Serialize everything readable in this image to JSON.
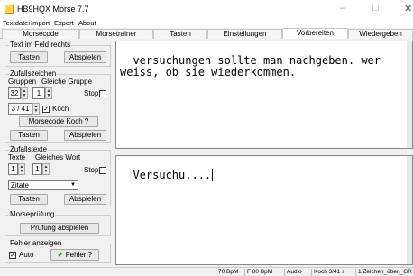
{
  "window": {
    "title": "HB9HQX Morse 7.7",
    "minimize": "–",
    "maximize": "□",
    "close": "✕"
  },
  "menu": [
    "Textdatei",
    "Import",
    "Export",
    "About"
  ],
  "tabs": [
    "Morsecode",
    "Morsetrainer",
    "Tasten",
    "Einstellungen",
    "Vorbereiten",
    "Wiedergeben"
  ],
  "active_tab": "Vorbereiten",
  "text_im_feld": {
    "legend": "Text im Feld rechts",
    "tasten": "Tasten",
    "abspielen": "Abspielen"
  },
  "zufallszeichen": {
    "legend": "Zufallszeichen",
    "gruppen_label": "Gruppen",
    "gleiche_gruppe_label": "Gleiche Gruppe",
    "gruppen_value": "32",
    "gleiche_value": "1",
    "stop_label": "Stop",
    "stop_checked": false,
    "koch_value": "3 / 41",
    "koch_label": "Koch",
    "koch_checked": true,
    "morsecode_koch_button": "Morsecode Koch ?",
    "tasten": "Tasten",
    "abspielen": "Abspielen"
  },
  "zufallstexte": {
    "legend": "Zufallstexte",
    "texte_label": "Texte",
    "gleiches_wort_label": "Gleiches Wort",
    "texte_value": "1",
    "wort_value": "1",
    "stop_label": "Stop",
    "stop_checked": false,
    "select_value": "Zitate",
    "tasten": "Tasten",
    "abspielen": "Abspielen"
  },
  "morsepruefung": {
    "legend": "Morseprüfung",
    "button": "Prüfung abspielen"
  },
  "fehler": {
    "legend": "Fehler anzeigen",
    "auto_label": "Auto",
    "auto_checked": true,
    "button": "Fehler ?",
    "check_color": "#2e9e2e"
  },
  "upper_text": "versuchungen sollte man nachgeben. wer\nweiss, ob sie wiederkommen.",
  "lower_text": "Versuchu....",
  "status": [
    "70 BpM",
    "F 80 BpM",
    "Audio",
    "Koch 3/41  s",
    "1 Zeichen_üben_GR"
  ]
}
